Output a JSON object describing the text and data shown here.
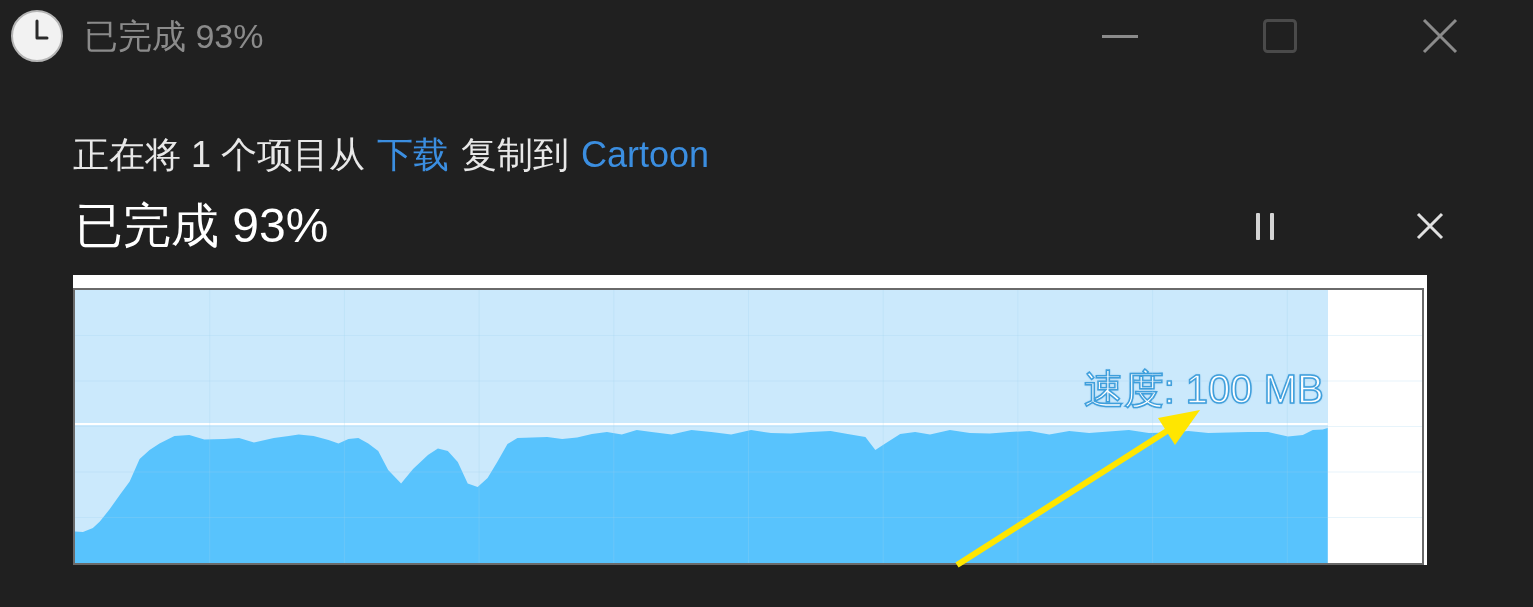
{
  "window": {
    "title": "已完成 93%"
  },
  "operation": {
    "parts": [
      {
        "kind": "text",
        "text": "正在将 1 个项目从"
      },
      {
        "kind": "link",
        "text": "下载"
      },
      {
        "kind": "text",
        "text": "复制到"
      },
      {
        "kind": "link",
        "text": "Cartoon"
      }
    ]
  },
  "progress": {
    "title": "已完成 93%",
    "level": 0.93,
    "speed_label": "速度: 100 MB"
  }
}
